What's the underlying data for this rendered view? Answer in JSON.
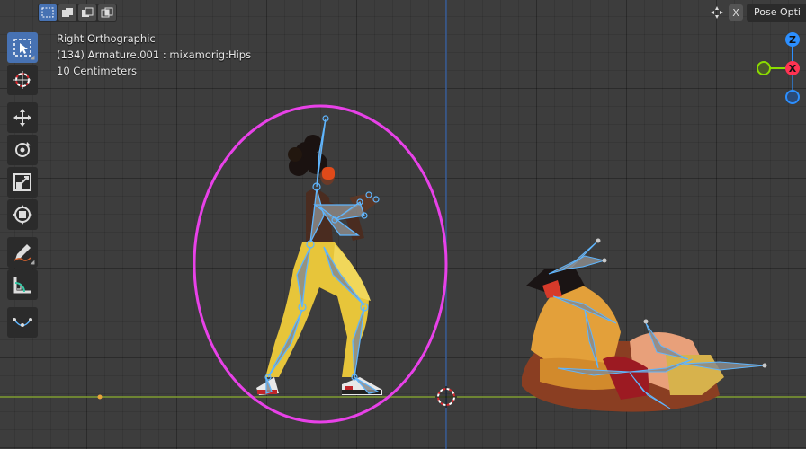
{
  "header": {
    "select_modes": [
      "select-new",
      "select-extend",
      "select-subtract",
      "select-intersect"
    ],
    "close_label": "X",
    "pose_options_label": "Pose Opti"
  },
  "toolbar": {
    "tools": [
      "select-box",
      "cursor",
      "move",
      "rotate",
      "scale",
      "transform",
      "annotate",
      "measure",
      "pose-tool"
    ]
  },
  "viewport_info": {
    "view_name": "Right Orthographic",
    "object_info": "(134) Armature.001 : mixamorig:Hips",
    "scale_info": "10 Centimeters"
  },
  "gizmo": {
    "z_label": "Z",
    "x_label": "X",
    "colors": {
      "z": "#2c8fff",
      "x": "#ff3352",
      "y": "#8bdc00"
    }
  },
  "colors": {
    "accent": "#4772b3",
    "selection_ellipse": "#e841e8",
    "ground_line": "#7f9d30",
    "vertical_axis": "#3b5f9a",
    "bone": "#9a9a9a",
    "bone_selected": "#5fb6ff"
  }
}
